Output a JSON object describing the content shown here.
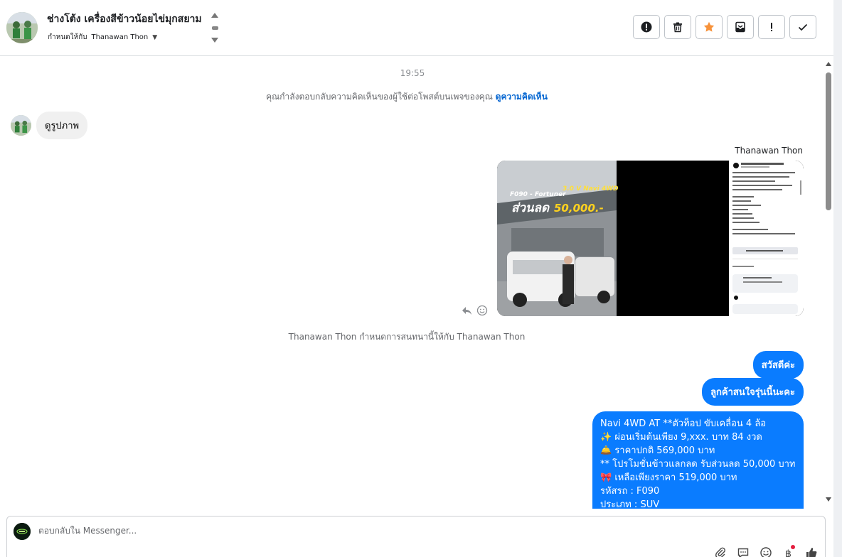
{
  "header": {
    "contact_name": "ช่างโต้ง เครื่องสีข้าวน้อยไข่มุกสยาม",
    "assign_prefix": "กำหนดให้กับ",
    "assignee": "Thanawan Thon"
  },
  "actions": [
    {
      "name": "report-spam-button",
      "icon": "alert-circle-icon"
    },
    {
      "name": "delete-button",
      "icon": "trash-icon"
    },
    {
      "name": "star-button",
      "icon": "star-icon"
    },
    {
      "name": "archive-button",
      "icon": "archive-icon"
    },
    {
      "name": "mark-important-button",
      "icon": "exclamation-icon"
    },
    {
      "name": "done-button",
      "icon": "check-icon"
    }
  ],
  "chat": {
    "timestamp": "19:55",
    "notice_text": "คุณกำลังตอบกลับความคิดเห็นของผู้ใช้ต่อโพสต์บนเพจของคุณ",
    "notice_link": "ดูความคิดเห็น",
    "incoming_message": "ดูรูปภาพ",
    "sender_name": "Thanawan Thon",
    "media": {
      "model_label": "F090 - Fortuner",
      "spec_label": "3.0 V Navi 4WD",
      "discount_label": "ส่วนลด",
      "discount_amount": "50,000.-"
    },
    "assigned_note": "Thanawan Thon กำหนดการสนทนานี้ให้กับ Thanawan Thon",
    "outgoing": [
      "สวัสดีค่ะ",
      "ลูกค้าสนใจรุ่นนี้นะคะ"
    ],
    "details_lines": [
      "Navi 4WD AT **ตัวท็อป ขับเคลื่อน 4 ล้อ",
      "✨ ผ่อนเริ่มต้นเพียง 9,xxx. บาท 84 งวด",
      "🛎️ ราคาปกติ 569,000 บาท",
      "** โปรโมชั่นข้าวแลกลด รับส่วนลด 50,000 บาท",
      "🎀 เหลือเพียงราคา 519,000 บาท",
      "รหัสรถ : F090",
      "ประเภท : SUV"
    ]
  },
  "composer": {
    "placeholder": "ตอบกลับใน Messenger...",
    "tools": [
      "attach-icon",
      "saved-replies-icon",
      "emoji-icon",
      "currency-icon",
      "like-icon"
    ]
  },
  "colors": {
    "accent_blue": "#0a7cff",
    "link_blue": "#0064d1",
    "star_orange": "#f7923a"
  }
}
